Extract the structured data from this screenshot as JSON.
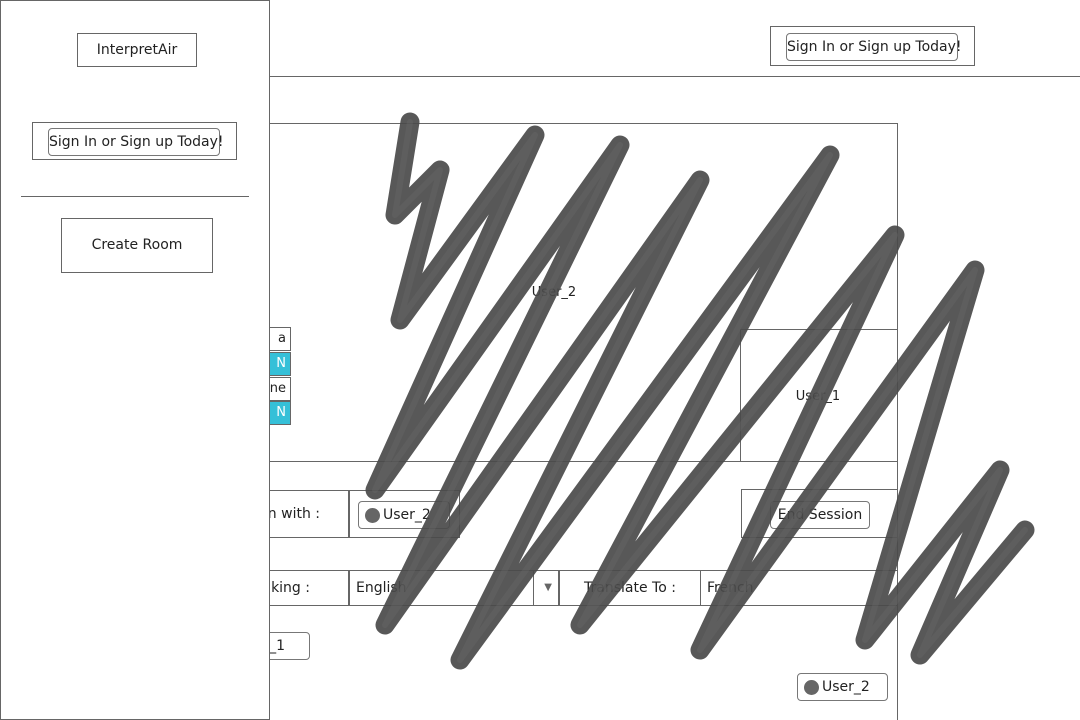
{
  "header": {
    "signin_label": "Sign In or Sign up Today!"
  },
  "sidebar": {
    "brand": "InterpretAir",
    "signin_label": "Sign In or Sign up Today!",
    "create_room_label": "Create Room"
  },
  "video": {
    "remote_user_label": "User_2",
    "local_user_label": "User_1"
  },
  "media_controls": {
    "camera_label": "a",
    "camera_state": "N",
    "mic_label": "one",
    "mic_state": "N"
  },
  "session": {
    "label": "on with :",
    "partner": "User_2",
    "end_label": "End Session"
  },
  "language": {
    "speaking_label": "aking :",
    "speaking_value": "English",
    "translate_label": "Translate To :",
    "translate_value": "French"
  },
  "messages": [
    {
      "user": "_1"
    },
    {
      "user": "User_2"
    }
  ],
  "colors": {
    "toggle_on": "#35c0d8",
    "border": "#666666",
    "scribble": "#4a4a4a"
  }
}
